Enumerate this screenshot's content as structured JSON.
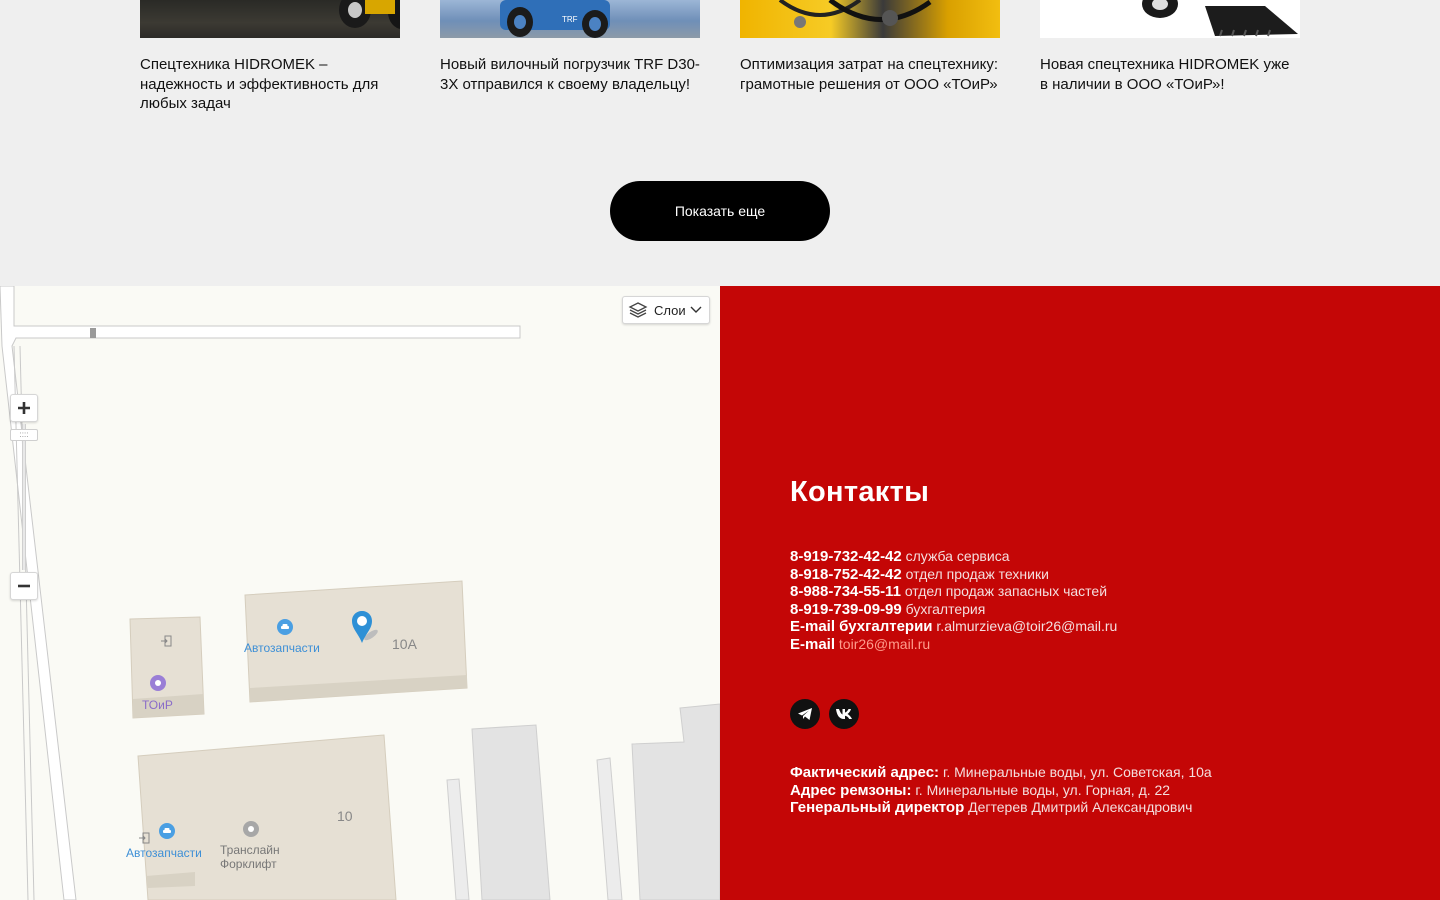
{
  "news": {
    "cards": [
      {
        "title": "Спецтехника HIDROMEK – надежность и эффективность для любых задач"
      },
      {
        "title": "Новый вилочный погрузчик TRF D30-3X отправился к своему владельцу!"
      },
      {
        "title": "Оптимизация затрат на спецтехнику: грамотные решения от ООО «ТОиР»"
      },
      {
        "title": "Новая спецтехника HIDROMEK уже в наличии в ООО «ТОиР»!"
      }
    ],
    "show_more_label": "Показать еще"
  },
  "map": {
    "layers_label": "Слои",
    "zoom_handle": "::::",
    "labels": {
      "autoparts_1": "Автозапчасти",
      "autoparts_2": "Автозапчасти",
      "toir": "ТОиР",
      "translain_1": "Транслайн",
      "translain_2": "Форклифт",
      "building_10a": "10А",
      "building_10": "10"
    }
  },
  "contacts": {
    "title": "Контакты",
    "phones": [
      {
        "number": "8-919-732-42-42",
        "desc": "служба сервиса"
      },
      {
        "number": "8-918-752-42-42",
        "desc": "отдел продаж техники"
      },
      {
        "number": "8-988-734-55-11",
        "desc": "отдел продаж запасных частей"
      },
      {
        "number": "8-919-739-09-99",
        "desc": "бухгалтерия"
      }
    ],
    "email_accounting_label": "E-mail бухгалтерии",
    "email_accounting": "r.almurzieva@toir26@mail.ru",
    "email_label": "E-mail",
    "email": "toir26@mail.ru",
    "address_label": "Фактический адрес:",
    "address": "г. Минеральные воды, ул. Советская, 10а",
    "repair_label": "Адрес ремзоны:",
    "repair_address": "г. Минеральные воды, ул. Горная, д. 22",
    "director_label": "Генеральный директор",
    "director": "Дегтерев Дмитрий Александрович"
  },
  "colors": {
    "contacts_bg": "#c40606",
    "button_bg": "#000000",
    "map_bg": "#fafaf5"
  }
}
